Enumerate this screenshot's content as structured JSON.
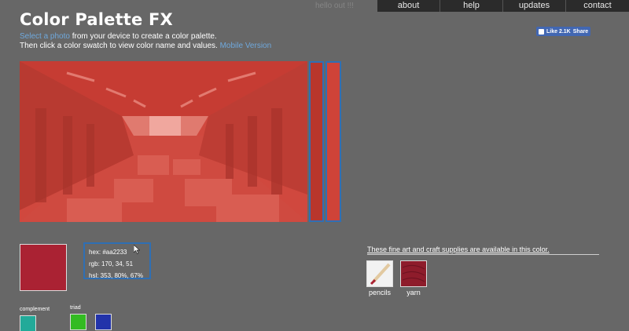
{
  "header": {
    "title": "Color Palette FX",
    "top_link": "hello out !!!",
    "intro_link": "Select a photo",
    "intro_line1_rest": " from your device to create a color palette.",
    "intro_line2": "Then click a color swatch to view color name and values.",
    "mobile_link": "Mobile Version"
  },
  "nav": {
    "items": [
      {
        "label": "about"
      },
      {
        "label": "help"
      },
      {
        "label": "updates"
      },
      {
        "label": "contact"
      }
    ]
  },
  "facebook": {
    "like_label": "Like 2.1K",
    "share_label": "Share"
  },
  "palette": {
    "selected_color": "#aa2233",
    "strip_colors": [
      "#b8362c",
      "#cf4338"
    ],
    "hex_text": "hex: #aa2233",
    "rgb_text": "rgb: 170, 34, 51",
    "hsl_text": "hsl: 353, 80%, 67%"
  },
  "supplies": {
    "heading": "These fine art and craft supplies are available in this color.",
    "items": [
      {
        "label": "pencils"
      },
      {
        "label": "yarn"
      }
    ]
  },
  "harmonies": {
    "complement_label": "complement",
    "complement_color": "#22aa99",
    "triad_label": "triad",
    "triad_colors": [
      "#33bb22",
      "#2233aa"
    ]
  }
}
